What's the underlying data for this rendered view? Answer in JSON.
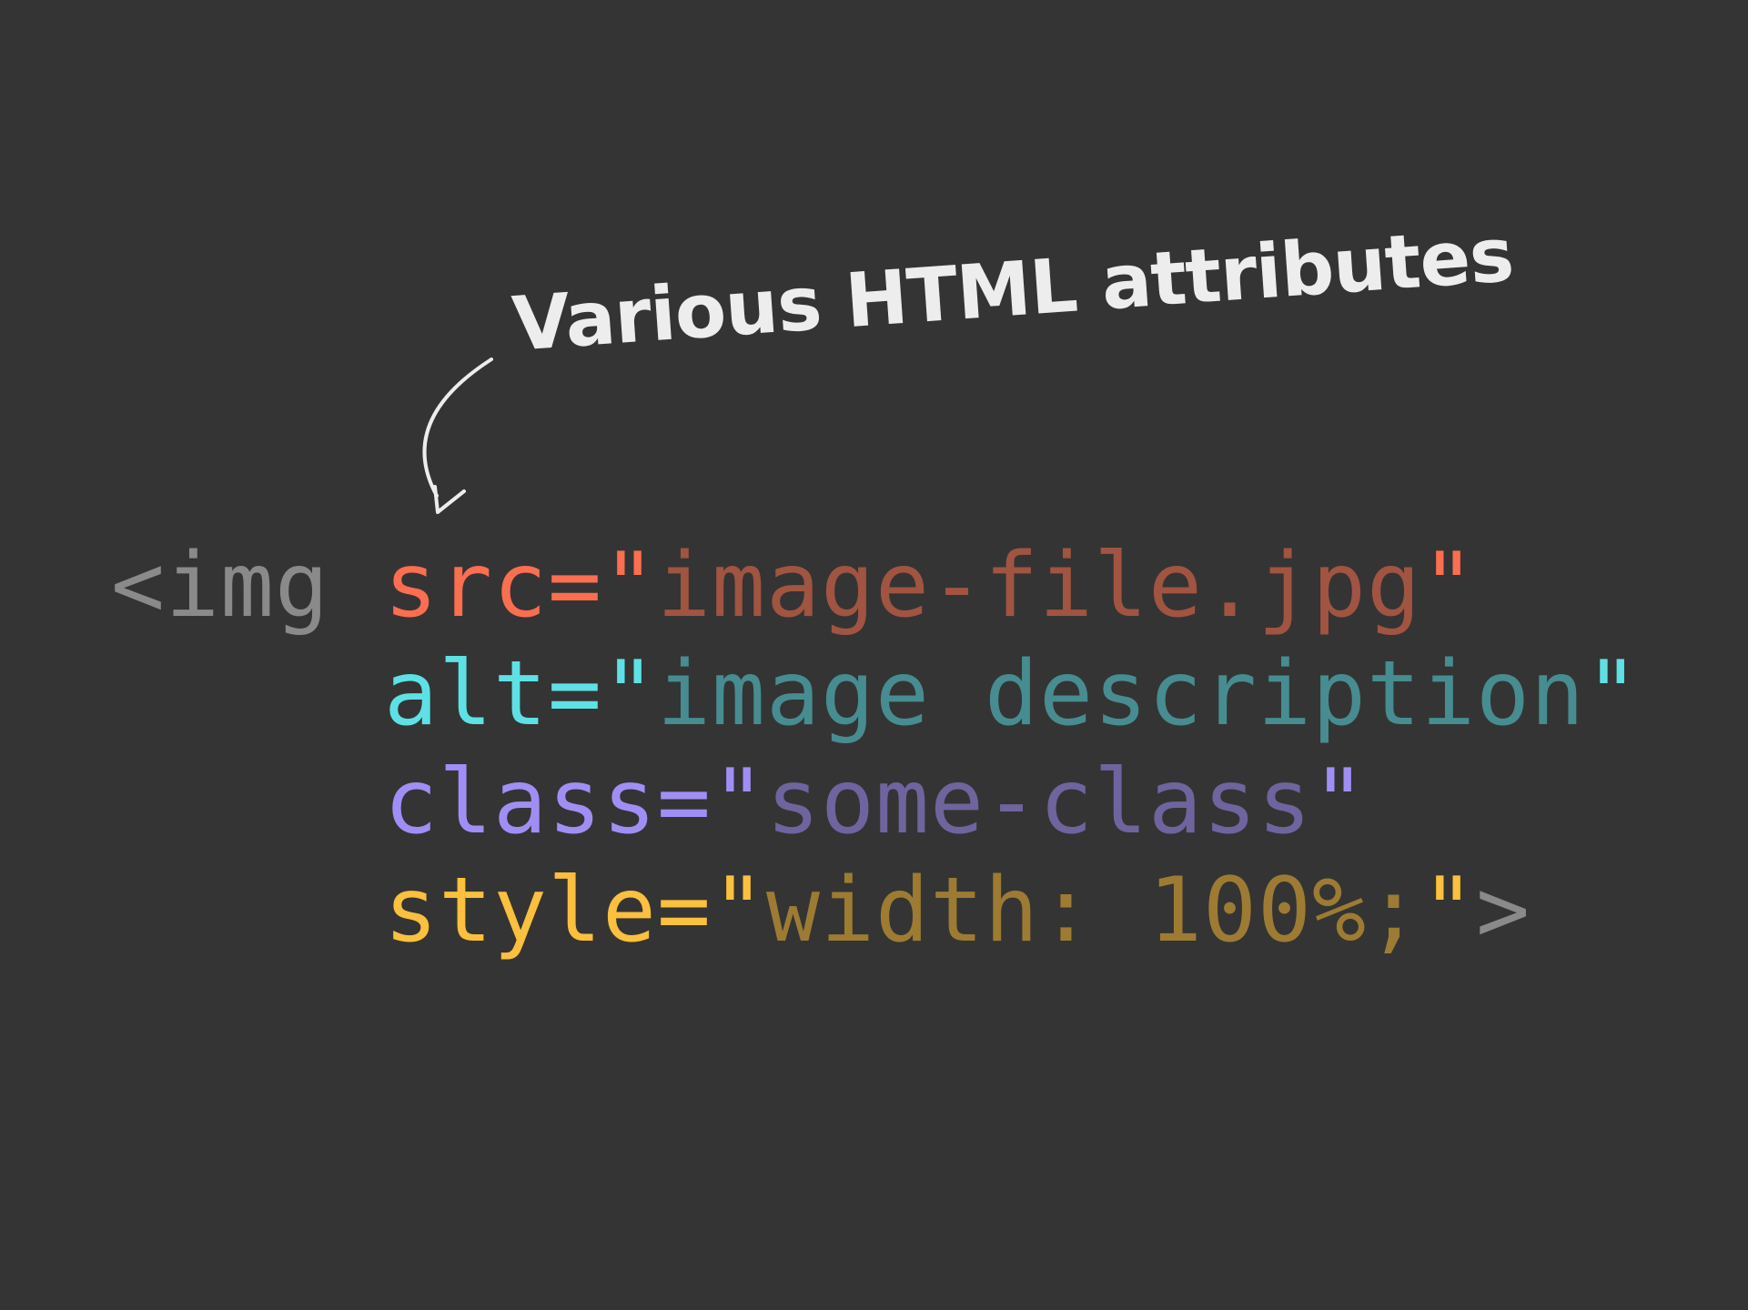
{
  "annotation": {
    "text": "Various HTML attributes",
    "color": "#ededed"
  },
  "background_color": "#343434",
  "code": {
    "lines": [
      {
        "indent": "",
        "tokens": [
          {
            "text": "<img ",
            "color": "#8a8a8a",
            "role": "tag-open"
          },
          {
            "text": "src=\"",
            "color": "#fb6e4f",
            "role": "attr-name"
          },
          {
            "text": "image-file.jpg",
            "color": "#a05441",
            "role": "attr-value"
          },
          {
            "text": "\"",
            "color": "#fb6e4f",
            "role": "attr-quote"
          }
        ]
      },
      {
        "indent": "     ",
        "tokens": [
          {
            "text": "alt=\"",
            "color": "#5ee1e5",
            "role": "attr-name"
          },
          {
            "text": "image description",
            "color": "#478c90",
            "role": "attr-value"
          },
          {
            "text": "\"",
            "color": "#5ee1e5",
            "role": "attr-quote"
          }
        ]
      },
      {
        "indent": "     ",
        "tokens": [
          {
            "text": "class=\"",
            "color": "#a18ef5",
            "role": "attr-name"
          },
          {
            "text": "some-class",
            "color": "#6f649e",
            "role": "attr-value"
          },
          {
            "text": "\"",
            "color": "#a18ef5",
            "role": "attr-quote"
          }
        ]
      },
      {
        "indent": "     ",
        "tokens": [
          {
            "text": "style=\"",
            "color": "#fac03e",
            "role": "attr-name"
          },
          {
            "text": "width: 100%;",
            "color": "#9d7b33",
            "role": "attr-value"
          },
          {
            "text": "\"",
            "color": "#fac03e",
            "role": "attr-quote"
          },
          {
            "text": ">",
            "color": "#8a8a8a",
            "role": "tag-close"
          }
        ]
      }
    ]
  }
}
